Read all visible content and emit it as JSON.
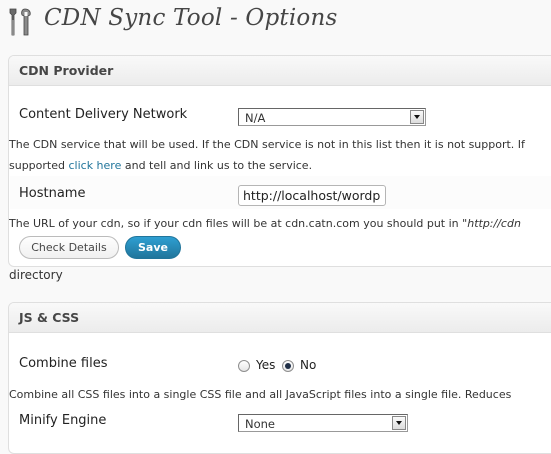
{
  "page": {
    "title": "CDN Sync Tool - Options",
    "icon": "tools-icon"
  },
  "cdn_provider": {
    "header": "CDN Provider",
    "network_label": "Content Delivery Network",
    "network_value": "N/A",
    "network_desc_1": "The CDN service that will be used. If the CDN service is not in this list then it is not support. If",
    "network_desc_2_prefix": "supported",
    "network_desc_2_link": "click here",
    "network_desc_2_suffix": "and tell and link us to the service.",
    "hostname_label": "Hostname",
    "hostname_value": "http://localhost/wordp",
    "hostname_desc": "The URL of your cdn, so if your cdn files will be at cdn.catn.com you should put in \"http://cdn",
    "check_button": "Check Details",
    "save_button": "Save"
  },
  "loose_text": "directory",
  "js_css": {
    "header": "JS & CSS",
    "combine_label": "Combine files",
    "combine_yes": "Yes",
    "combine_no": "No",
    "combine_selected": "No",
    "combine_desc": "Combine all CSS files into a single CSS file and all JavaScript files into a single file. Reduces",
    "minify_label": "Minify Engine",
    "minify_value": "None"
  },
  "colors": {
    "link": "#21759b",
    "primary_button": "#21759b"
  }
}
